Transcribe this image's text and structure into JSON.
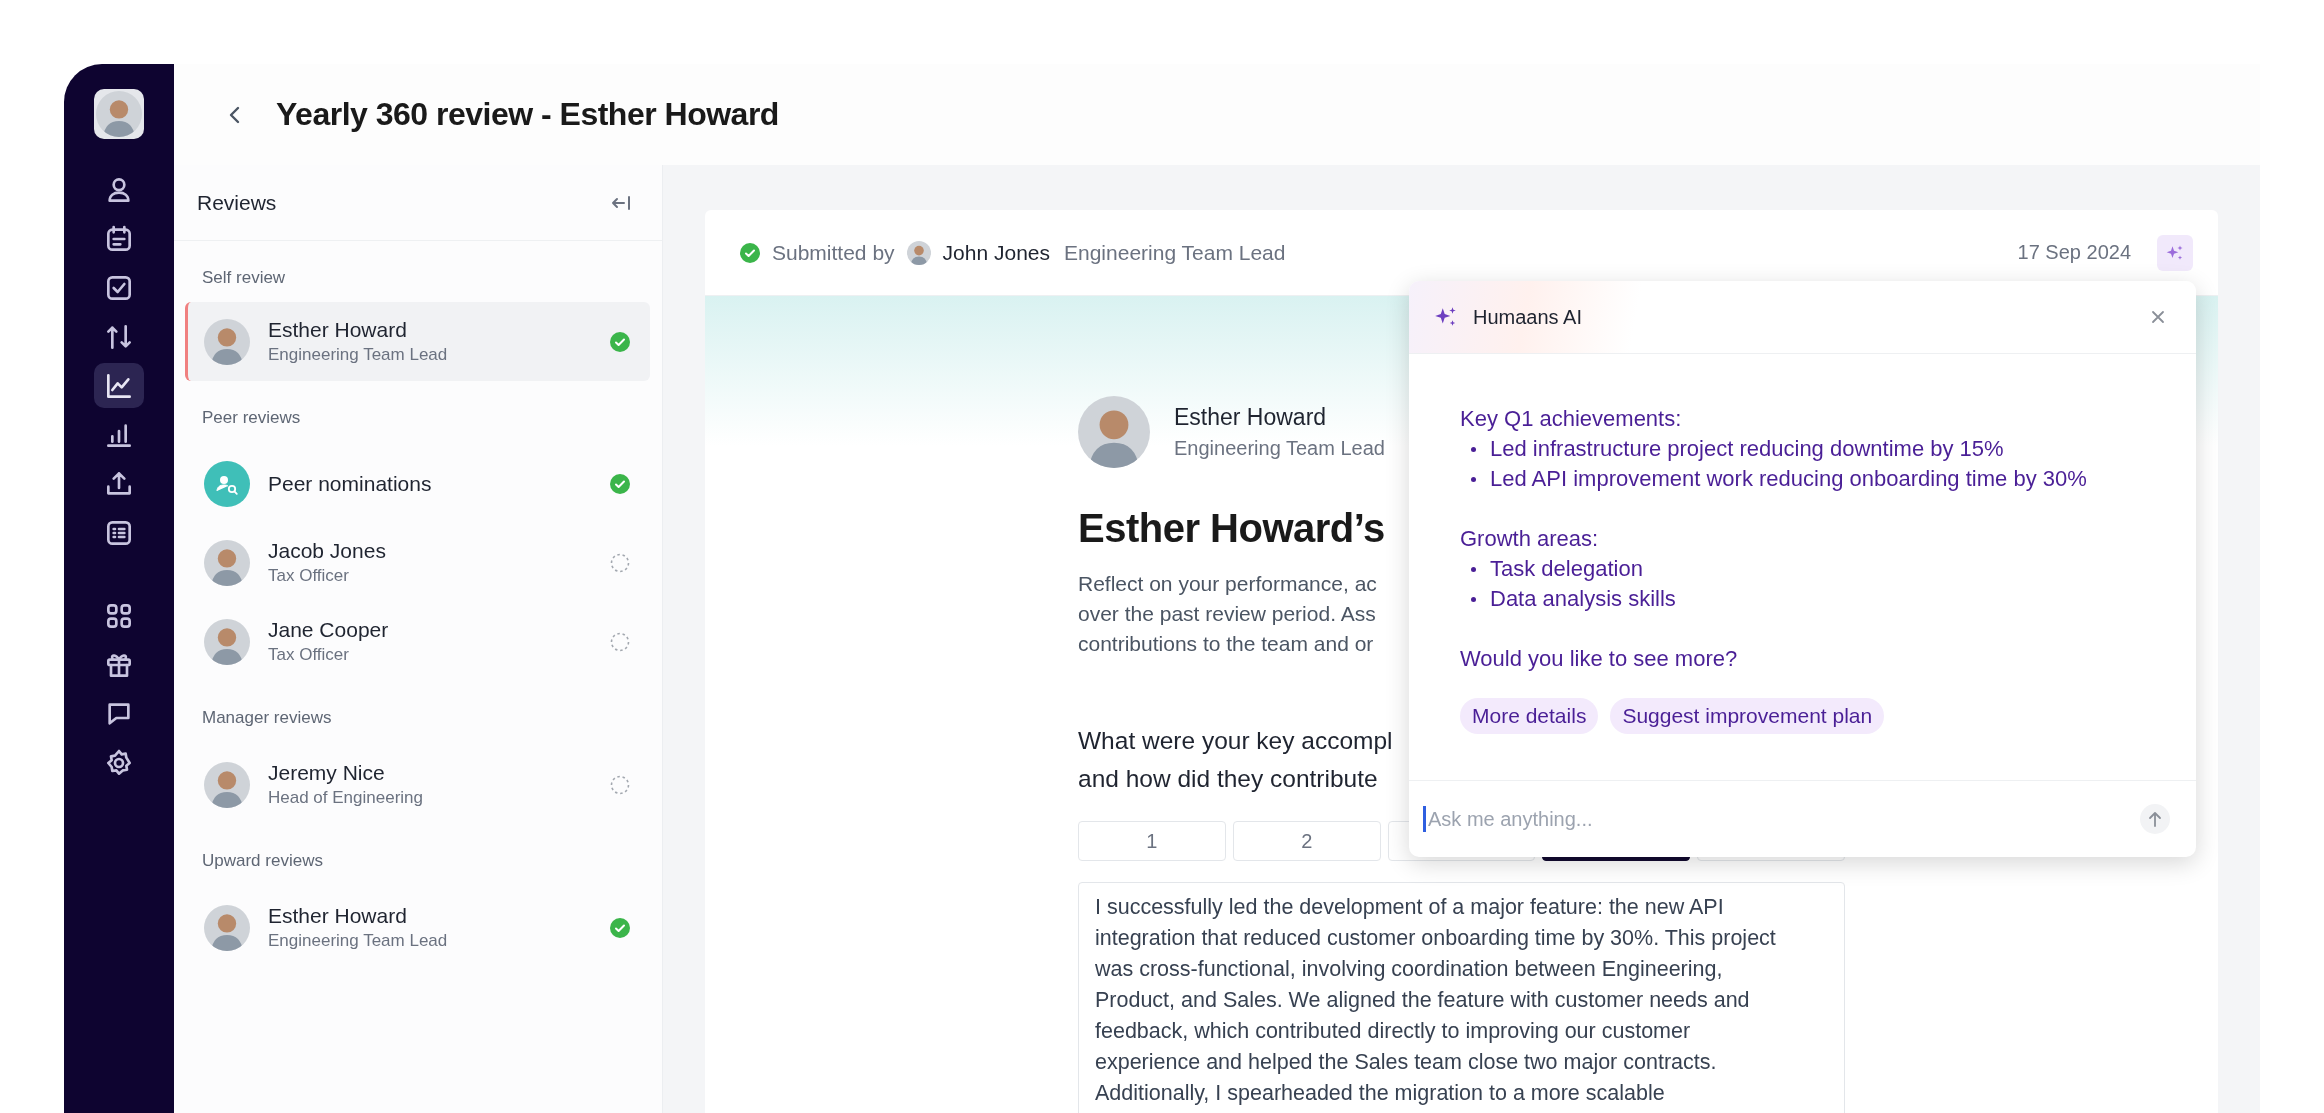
{
  "sidebar": {
    "nav_groups": [
      [
        {
          "selected": false
        },
        {
          "selected": false
        },
        {
          "selected": false
        },
        {
          "selected": false
        },
        {
          "selected": true
        },
        {
          "selected": false
        },
        {
          "selected": false
        },
        {
          "selected": false
        }
      ],
      [
        {
          "selected": false
        },
        {
          "selected": false
        },
        {
          "selected": false
        },
        {
          "selected": false
        }
      ]
    ]
  },
  "header": {
    "title": "Yearly 360 review - Esther Howard"
  },
  "reviews_panel": {
    "title": "Reviews",
    "sections": [
      {
        "heading": "Self review",
        "items": [
          {
            "kind": "person",
            "name": "Esther Howard",
            "role": "Engineering Team Lead",
            "selected": true,
            "completed": true
          }
        ]
      },
      {
        "heading": "Peer reviews",
        "items": [
          {
            "kind": "nominations",
            "name": "Peer nominations",
            "selected": false,
            "completed": true
          },
          {
            "kind": "person",
            "name": "Jacob Jones",
            "role": "Tax Officer",
            "selected": false,
            "completed": false
          },
          {
            "kind": "person",
            "name": "Jane Cooper",
            "role": "Tax Officer",
            "selected": false,
            "completed": false
          }
        ]
      },
      {
        "heading": "Manager reviews",
        "items": [
          {
            "kind": "person",
            "name": "Jeremy Nice",
            "role": "Head of Engineering",
            "selected": false,
            "completed": false
          }
        ]
      },
      {
        "heading": "Upward reviews",
        "items": [
          {
            "kind": "person",
            "name": "Esther Howard",
            "role": "Engineering Team Lead",
            "selected": false,
            "completed": true
          }
        ]
      }
    ]
  },
  "submission": {
    "completed": true,
    "label": "Submitted by",
    "name": "John Jones",
    "role": "Engineering Team Lead",
    "date": "17 Sep 2024"
  },
  "review": {
    "name": "Esther Howard",
    "role": "Engineering Team Lead",
    "heading": "Esther Howard’s",
    "intro_lines": [
      "Reflect on your performance, ac",
      "over the past review period. Ass",
      "contributions to the team and or"
    ],
    "question_lines": [
      "What were your key accompl",
      "and how did they contribute"
    ],
    "scale": [
      {
        "label": "1",
        "selected": false
      },
      {
        "label": "2",
        "selected": false
      },
      {
        "selected": false
      },
      {
        "selected": true
      },
      {
        "selected": false
      }
    ],
    "answer": "I successfully led the development of a major feature: the new API\nintegration that reduced customer onboarding time by 30%. This project\nwas cross-functional, involving coordination between Engineering,\nProduct, and Sales. We aligned the feature with customer needs and\nfeedback, which contributed directly to improving our customer\nexperience and helped the Sales team close two major contracts.\nAdditionally, I spearheaded the migration to a more scalable"
  },
  "ai_panel": {
    "title": "Humaans AI",
    "sections": [
      {
        "heading": "Key Q1 achievements:",
        "bullets": [
          "Led infrastructure project reducing downtime by 15%",
          "Led API improvement work reducing onboarding time by 30%"
        ]
      },
      {
        "heading": "Growth areas:",
        "bullets": [
          "Task delegation",
          "Data analysis skills"
        ]
      }
    ],
    "question": "Would you like to see more?",
    "suggestions": [
      "More details",
      "Suggest improvement plan"
    ],
    "input": {
      "placeholder": "Ask me anything..."
    }
  }
}
